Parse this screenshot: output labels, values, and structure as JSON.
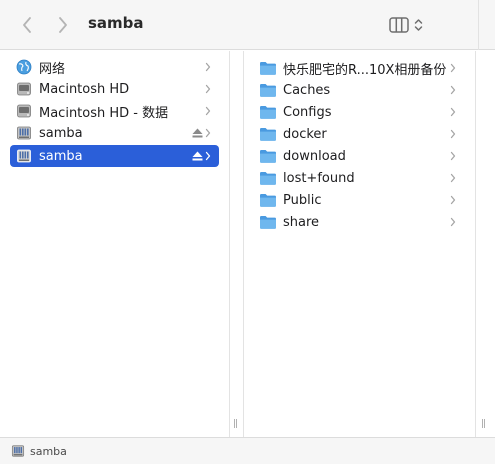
{
  "window": {
    "title": "samba"
  },
  "sidebar": {
    "items": [
      {
        "label": "网络",
        "icon": "network-globe-icon",
        "eject": false,
        "selected": false
      },
      {
        "label": "Macintosh HD",
        "icon": "hard-drive-icon",
        "eject": false,
        "selected": false
      },
      {
        "label": "Macintosh HD - 数据",
        "icon": "hard-drive-icon",
        "eject": false,
        "selected": false
      },
      {
        "label": "samba",
        "icon": "network-server-icon",
        "eject": true,
        "selected": false
      },
      {
        "label": "samba",
        "icon": "network-server-icon",
        "eject": true,
        "selected": true
      }
    ]
  },
  "content": {
    "items": [
      {
        "label": "快乐肥宅的R...10X相册备份",
        "icon": "folder-icon"
      },
      {
        "label": "Caches",
        "icon": "folder-icon"
      },
      {
        "label": "Configs",
        "icon": "folder-icon"
      },
      {
        "label": "docker",
        "icon": "folder-icon"
      },
      {
        "label": "download",
        "icon": "folder-icon"
      },
      {
        "label": "lost+found",
        "icon": "folder-icon"
      },
      {
        "label": "Public",
        "icon": "folder-icon"
      },
      {
        "label": "share",
        "icon": "folder-icon"
      }
    ]
  },
  "statusbar": {
    "path_label": "samba",
    "icon": "network-server-icon"
  },
  "colors": {
    "selection": "#2b5fd9",
    "folder": "#5aa9e6"
  }
}
